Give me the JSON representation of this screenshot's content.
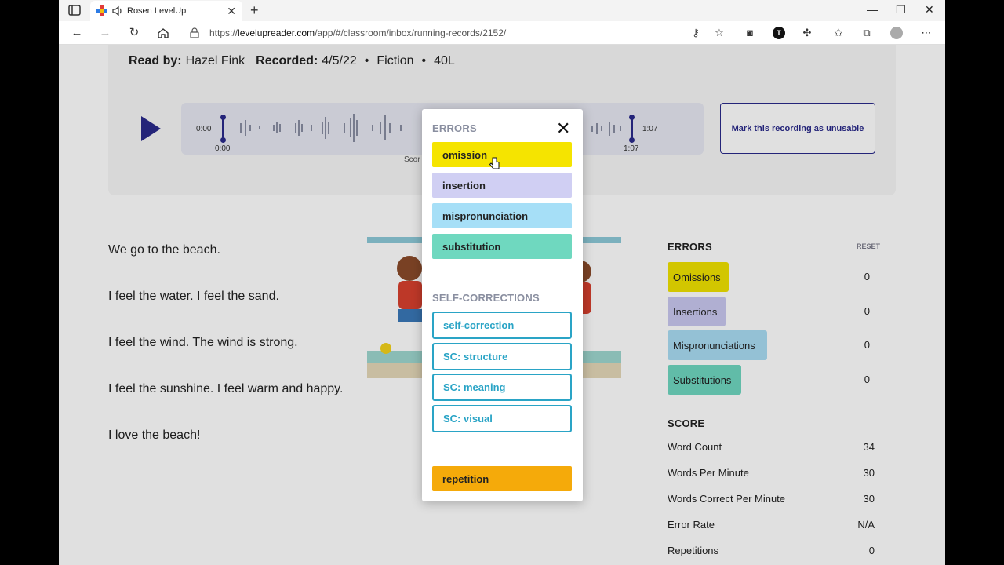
{
  "browser": {
    "tab_title": "Rosen LevelUp",
    "url_prefix": "https://",
    "url_host": "levelupreader.com",
    "url_path": "/app/#/classroom/inbox/running-records/2152/"
  },
  "header": {
    "read_by_label": "Read by:",
    "reader": "Hazel Fink",
    "recorded_label": "Recorded:",
    "recorded_date": "4/5/22",
    "genre": "Fiction",
    "level": "40L",
    "bullet": "•"
  },
  "player": {
    "time_start": "0:00",
    "time_end": "1:07",
    "handle_start_label": "0:00",
    "handle_end_label": "1:07",
    "score_caption": "Scor",
    "unusable_label": "Mark this recording as unusable"
  },
  "story": {
    "paragraphs": [
      "We go to the beach.",
      "I feel the water. I feel the sand.",
      "I feel the wind. The wind is strong.",
      "I feel the sunshine. I feel warm and happy.",
      "I love the beach!"
    ]
  },
  "sidebar": {
    "errors_heading": "ERRORS",
    "reset_label": "RESET",
    "errors": [
      {
        "label": "Omissions",
        "count": "0",
        "color": "#f0e200"
      },
      {
        "label": "Insertions",
        "count": "0",
        "color": "#c9c8ef"
      },
      {
        "label": "Mispronunciations",
        "count": "0",
        "color": "#a9dcf3"
      },
      {
        "label": "Substitutions",
        "count": "0",
        "color": "#6fd6c0"
      }
    ],
    "score_heading": "SCORE",
    "scores": [
      {
        "label": "Word Count",
        "value": "34"
      },
      {
        "label": "Words Per Minute",
        "value": "30"
      },
      {
        "label": "Words Correct Per Minute",
        "value": "30"
      },
      {
        "label": "Error Rate",
        "value": "N/A"
      },
      {
        "label": "Repetitions",
        "value": "0"
      }
    ]
  },
  "popup": {
    "errors_heading": "ERRORS",
    "close_icon": "close-icon",
    "error_buttons": [
      {
        "label": "omission",
        "color": "#f5e400"
      },
      {
        "label": "insertion",
        "color": "#d0cff3"
      },
      {
        "label": "mispronunciation",
        "color": "#a6dff7"
      },
      {
        "label": "substitution",
        "color": "#6fd8bf"
      }
    ],
    "self_corrections_heading": "SELF-CORRECTIONS",
    "self_correction_buttons": [
      "self-correction",
      "SC: structure",
      "SC: meaning",
      "SC: visual"
    ],
    "repetition_label": "repetition",
    "repetition_color": "#f5aa0a"
  }
}
